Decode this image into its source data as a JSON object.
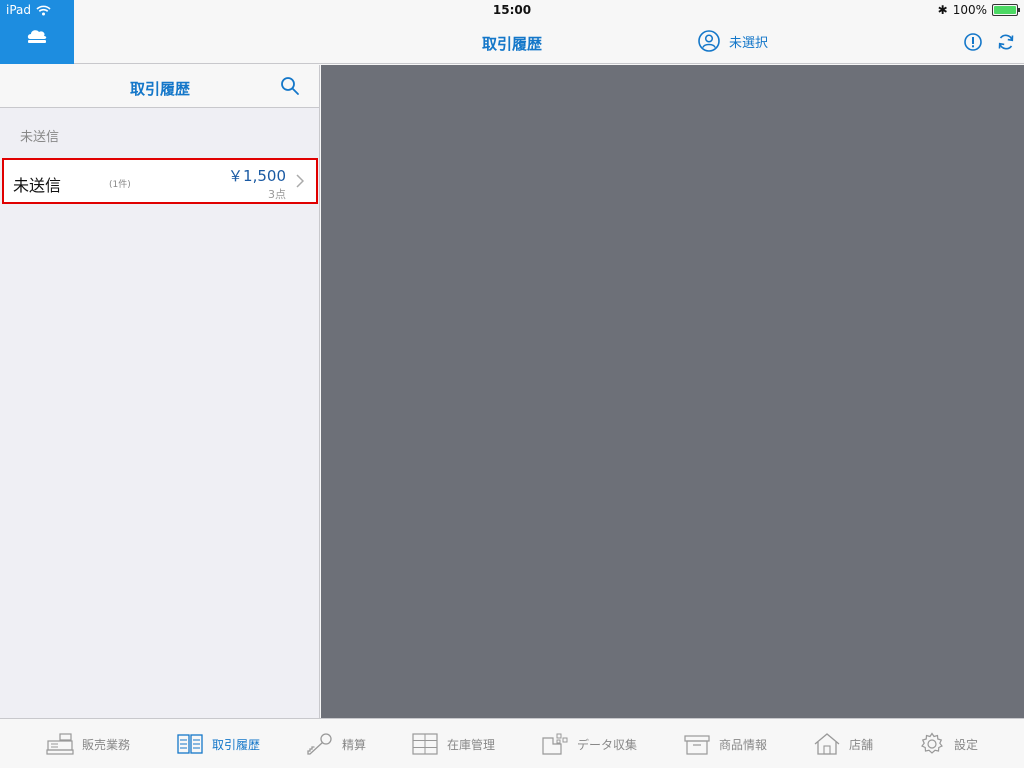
{
  "status_bar": {
    "device": "iPad",
    "time": "15:00",
    "battery": "100%",
    "battery_level": 1.0
  },
  "nav": {
    "title": "取引履歴",
    "user_label": "未選択"
  },
  "master": {
    "title": "取引履歴",
    "section": "未送信",
    "rows": [
      {
        "title": "未送信",
        "count": "(1件)",
        "amount": "￥1,500",
        "qty": "3点"
      }
    ]
  },
  "tabs": [
    {
      "label": "販売業務",
      "icon": "cash-register-icon"
    },
    {
      "label": "取引履歴",
      "icon": "ledger-book-icon"
    },
    {
      "label": "精算",
      "icon": "key-icon"
    },
    {
      "label": "在庫管理",
      "icon": "cabinet-icon"
    },
    {
      "label": "データ収集",
      "icon": "data-collection-icon"
    },
    {
      "label": "商品情報",
      "icon": "product-box-icon"
    },
    {
      "label": "店舗",
      "icon": "store-house-icon"
    },
    {
      "label": "設定",
      "icon": "gear-icon"
    }
  ],
  "colors": {
    "accent": "#1477c9",
    "logo_bg": "#1d8de0",
    "detail_bg": "#6d7078",
    "highlight_border": "#e00000"
  }
}
